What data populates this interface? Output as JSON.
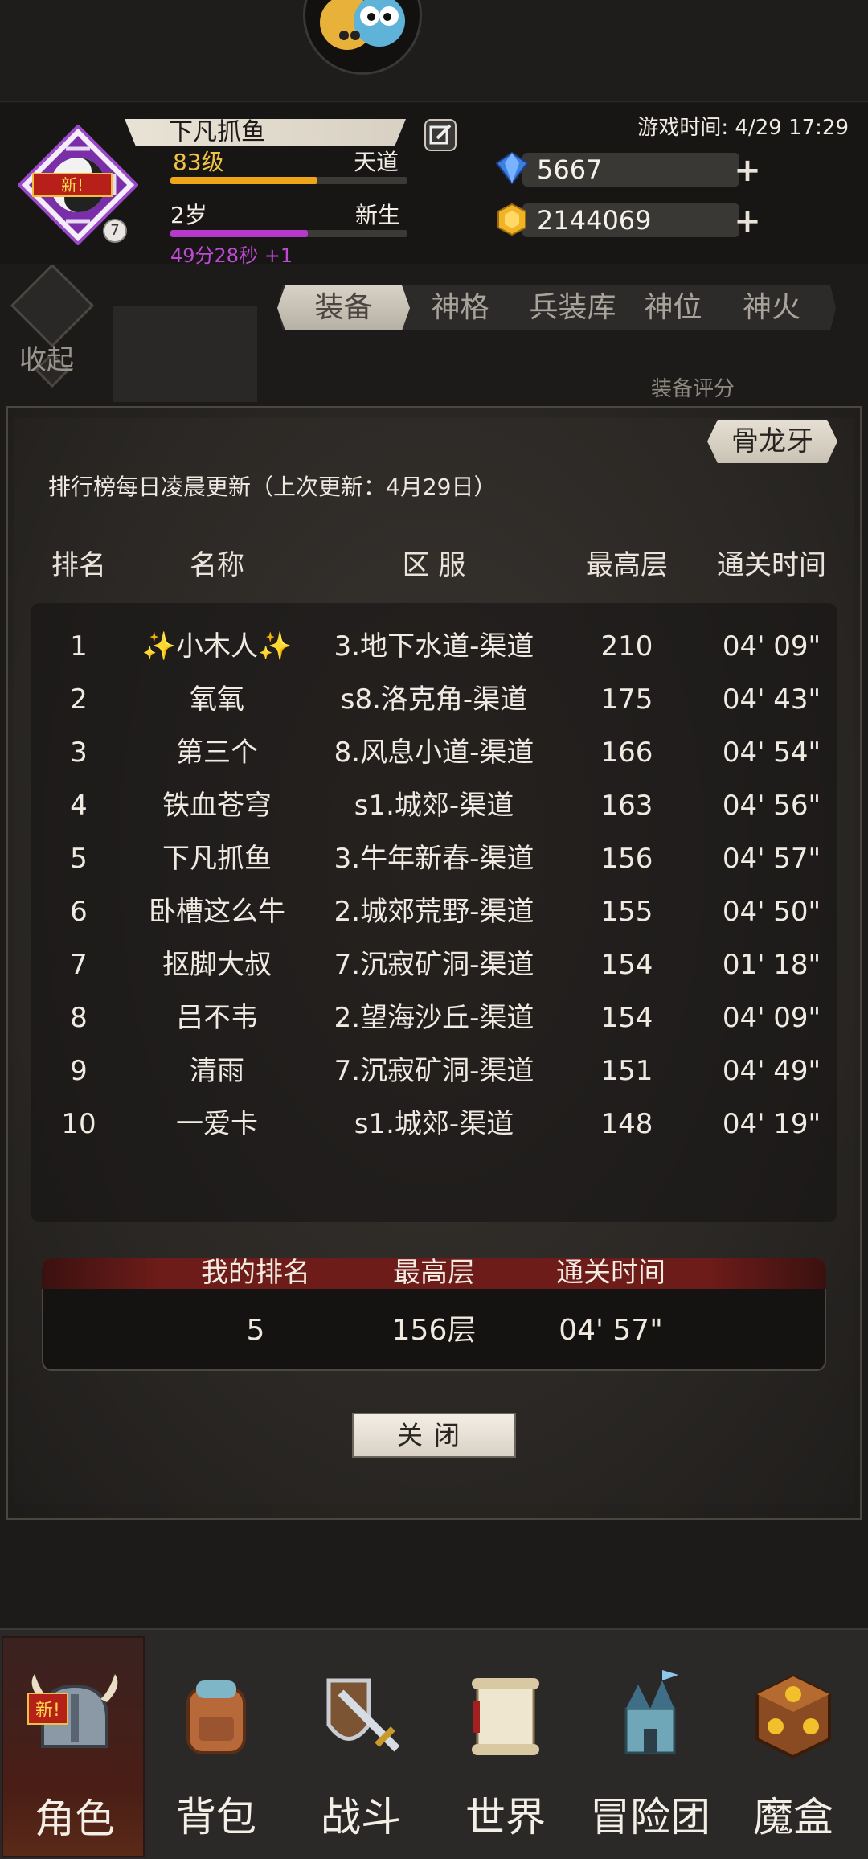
{
  "header": {
    "player_name": "下凡抓鱼",
    "level": "83级",
    "level_realm": "天道",
    "level_progress": 0.62,
    "age": "2岁",
    "age_status": "新生",
    "age_progress": 0.58,
    "timer": "49分28秒 +1",
    "emblem_badge": "新!",
    "emblem_number": "7",
    "game_time": "游戏时间: 4/29 17:29",
    "gems": "5667",
    "gold": "2144069"
  },
  "side": {
    "collapse_label": "收起"
  },
  "tabs": [
    {
      "label": "装备"
    },
    {
      "label": "神格"
    },
    {
      "label": "兵装库"
    },
    {
      "label": "神位"
    },
    {
      "label": "神火"
    }
  ],
  "equip_score_label": "装备评分",
  "boss_tag": "骨龙牙",
  "update_note": "排行榜每日凌晨更新（上次更新：4月29日）",
  "columns": {
    "rank": "排名",
    "name": "名称",
    "server": "区 服",
    "floor": "最高层",
    "time": "通关时间"
  },
  "rows": [
    {
      "rank": "1",
      "name": "✨小木人✨",
      "server": "3.地下水道-渠道",
      "floor": "210",
      "time": "04' 09\""
    },
    {
      "rank": "2",
      "name": "氧氧",
      "server": "s8.洛克角-渠道",
      "floor": "175",
      "time": "04' 43\""
    },
    {
      "rank": "3",
      "name": "第三个",
      "server": "8.风息小道-渠道",
      "floor": "166",
      "time": "04' 54\""
    },
    {
      "rank": "4",
      "name": "铁血苍穹",
      "server": "s1.城郊-渠道",
      "floor": "163",
      "time": "04' 56\""
    },
    {
      "rank": "5",
      "name": "下凡抓鱼",
      "server": "3.牛年新春-渠道",
      "floor": "156",
      "time": "04' 57\""
    },
    {
      "rank": "6",
      "name": "卧槽这么牛",
      "server": "2.城郊荒野-渠道",
      "floor": "155",
      "time": "04' 50\""
    },
    {
      "rank": "7",
      "name": "抠脚大叔",
      "server": "7.沉寂矿洞-渠道",
      "floor": "154",
      "time": "01' 18\""
    },
    {
      "rank": "8",
      "name": "吕不韦",
      "server": "2.望海沙丘-渠道",
      "floor": "154",
      "time": "04' 09\""
    },
    {
      "rank": "9",
      "name": "清雨",
      "server": "7.沉寂矿洞-渠道",
      "floor": "151",
      "time": "04' 49\""
    },
    {
      "rank": "10",
      "name": "一爱卡",
      "server": "s1.城郊-渠道",
      "floor": "148",
      "time": "04' 19\""
    }
  ],
  "my_rank": {
    "rank_label": "我的排名",
    "floor_label": "最高层",
    "time_label": "通关时间",
    "rank": "5",
    "floor": "156层",
    "time": "04' 57\""
  },
  "close_label": "关闭",
  "nav": [
    {
      "label": "角色",
      "icon": "helmet-icon",
      "badge": "新!"
    },
    {
      "label": "背包",
      "icon": "backpack-icon"
    },
    {
      "label": "战斗",
      "icon": "sword-shield-icon"
    },
    {
      "label": "世界",
      "icon": "scroll-icon"
    },
    {
      "label": "冒险团",
      "icon": "castle-icon"
    },
    {
      "label": "魔盒",
      "icon": "magic-box-icon"
    }
  ]
}
